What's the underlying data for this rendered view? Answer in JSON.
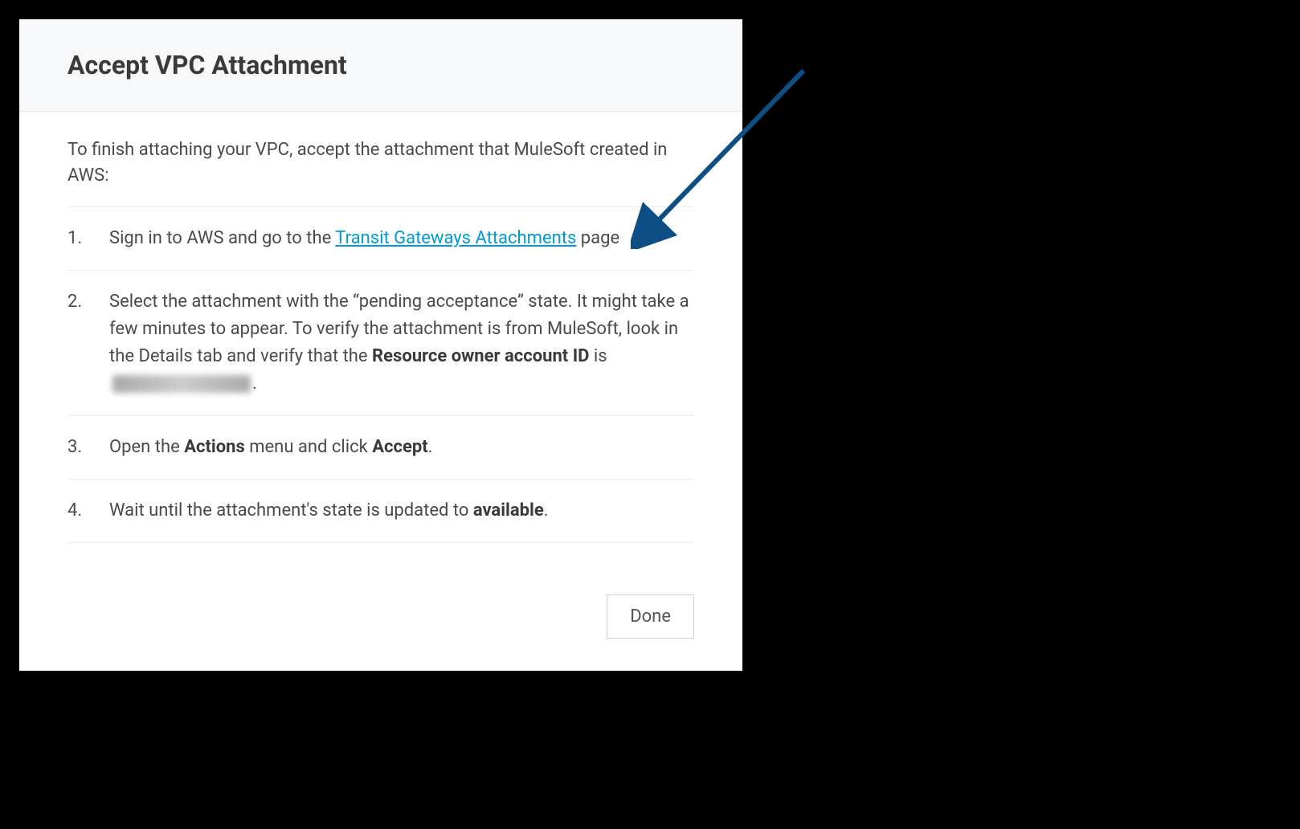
{
  "dialog": {
    "title": "Accept VPC Attachment",
    "intro": "To finish attaching your VPC, accept the attachment that MuleSoft created in AWS:",
    "steps": {
      "s1": {
        "num": "1.",
        "prefix": "Sign in to AWS and go to the ",
        "link": "Transit Gateways Attachments",
        "suffix": " page"
      },
      "s2": {
        "num": "2.",
        "p1": "Select the attachment with the “pending acceptance” state. It might take a few minutes to appear. To verify the attachment is from MuleSoft, look in the Details tab and verify that the ",
        "bold1": "Resource owner account ID",
        "p2": " is ",
        "p3": "."
      },
      "s3": {
        "num": "3.",
        "p1": "Open the ",
        "bold1": "Actions",
        "p2": " menu and click ",
        "bold2": "Accept",
        "p3": "."
      },
      "s4": {
        "num": "4.",
        "p1": "Wait until the attachment's state is updated to ",
        "bold1": "available",
        "p2": "."
      }
    },
    "done": "Done"
  },
  "colors": {
    "link": "#0099d9",
    "arrow": "#0d4f85"
  }
}
